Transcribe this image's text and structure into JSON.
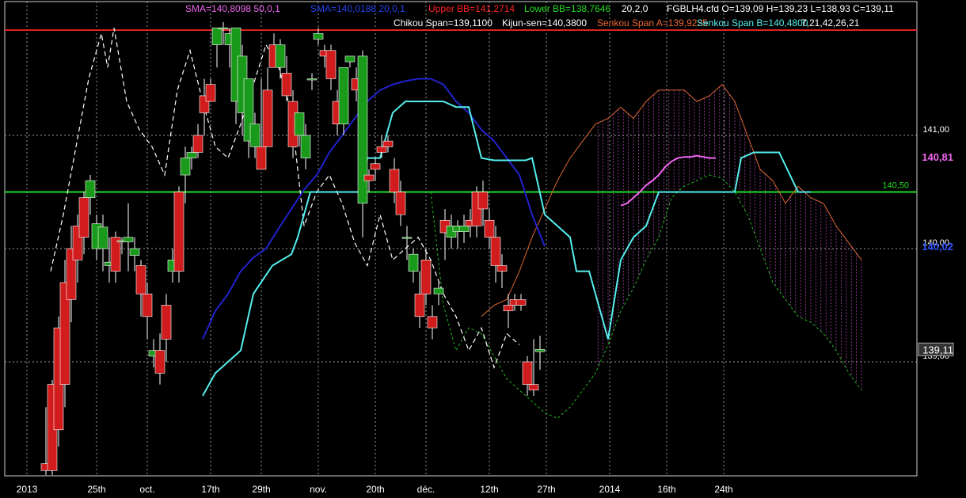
{
  "header": {
    "sma1": "SMA=140,8098  50,0,1",
    "sma2": "SMA=140,0188  20,0,1",
    "upper_bb": "Upper BB=141,2714",
    "lower_bb": "Lower BB=138,7646",
    "bb_params": "20,2,0",
    "ohlc": "FGBLH4.cfd O=139,09 H=139,23 L=138,93 C=139,11",
    "chikou": "Chikou Span=139,1100",
    "kijun": "Kijun-sen=140,3800",
    "senkou_a": "Senkou Span A=139,9225",
    "senkou_b": "Senkou Span B=140,4800",
    "ichimoku_params": "7,21,42,26,21"
  },
  "colors": {
    "background": "#000000",
    "bull": "#1a9a1a",
    "bear": "#d01c1c",
    "upper_bb": "#dd2222",
    "hline": "#22dd22",
    "sma50": "#ee66ee",
    "sma20": "#2222cc",
    "kijun": "#55eeee",
    "chikou": "#ffffff",
    "senkou_a": "#dd6633",
    "senkou_b": "#22bb22",
    "sma1_label": "#ee66ee",
    "sma2_label": "#2244ee",
    "upper_label": "#ff2222",
    "lower_label": "#22dd22",
    "white_label": "#ffffff",
    "senkou_a_label": "#ee6633",
    "senkou_b_label": "#55eeee"
  },
  "chart_data": {
    "type": "candlestick",
    "instrument": "FGBLH4.cfd",
    "ylim": [
      138.0,
      142.0
    ],
    "y_ticks": [
      "141,00",
      "140,00",
      "139,00"
    ],
    "y_tick_values": [
      141.0,
      140.0,
      139.0
    ],
    "x_ticks": [
      "2013",
      "25th",
      "oct.",
      "17th",
      "29th",
      "nov.",
      "20th",
      "déc.",
      "12th",
      "27th",
      "2014",
      "16th",
      "24th"
    ],
    "x_tick_index": [
      0,
      11,
      19,
      29,
      37,
      46,
      55,
      63,
      73,
      82,
      92,
      101,
      110
    ],
    "price_labels": {
      "sma50": "140,81",
      "sma20": "140,02",
      "last": "139,11",
      "hline": "140,50"
    },
    "sma50_value": 140.81,
    "sma20_value": 140.02,
    "last_value": 139.11,
    "hline_value": 140.5,
    "upper_bb_value": 141.93,
    "candles": [
      [
        138.1,
        138.04,
        138.0,
        138.6
      ],
      [
        138.8,
        138.04,
        138.0,
        138.84
      ],
      [
        139.3,
        138.4,
        138.25,
        139.4
      ],
      [
        139.7,
        138.8,
        138.6,
        139.9
      ],
      [
        140.0,
        139.55,
        139.35,
        140.2
      ],
      [
        140.2,
        139.9,
        139.7,
        140.3
      ],
      [
        140.45,
        140.1,
        139.95,
        140.5
      ],
      [
        140.45,
        140.6,
        140.3,
        140.65
      ],
      [
        140.0,
        140.22,
        139.9,
        140.3
      ],
      [
        140.0,
        140.19,
        139.8,
        140.3
      ],
      [
        139.85,
        139.88,
        139.7,
        140.1
      ],
      [
        140.1,
        139.8,
        139.7,
        140.15
      ],
      [
        140.06,
        140.07,
        139.95,
        140.1
      ],
      [
        140.06,
        140.1,
        139.8,
        140.4
      ],
      [
        139.94,
        140.0,
        139.8,
        140.1
      ],
      [
        139.85,
        139.6,
        139.4,
        139.9
      ],
      [
        139.6,
        139.4,
        139.2,
        139.7
      ],
      [
        139.05,
        139.1,
        138.95,
        139.2
      ],
      [
        139.1,
        138.9,
        138.8,
        139.25
      ],
      [
        139.5,
        139.2,
        139.0,
        139.6
      ],
      [
        139.8,
        139.9,
        139.7,
        140.0
      ],
      [
        140.5,
        139.8,
        139.7,
        140.55
      ],
      [
        140.65,
        140.8,
        140.4,
        140.9
      ],
      [
        140.8,
        140.85,
        140.7,
        140.9
      ],
      [
        141.0,
        140.85,
        140.8,
        141.1
      ],
      [
        141.35,
        141.2,
        141.0,
        141.5
      ],
      [
        141.45,
        141.3,
        141.4,
        141.5
      ],
      [
        141.8,
        141.95,
        141.6,
        141.9
      ],
      [
        141.95,
        141.95,
        141.8,
        142.0
      ],
      [
        141.8,
        141.9,
        141.6,
        141.95
      ],
      [
        141.3,
        141.95,
        141.1,
        141.9
      ],
      [
        141.2,
        141.7,
        141.0,
        141.8
      ],
      [
        140.95,
        141.5,
        140.8,
        141.5
      ],
      [
        140.9,
        141.1,
        140.8,
        141.2
      ],
      [
        140.9,
        140.7,
        140.7,
        141.5
      ],
      [
        141.4,
        140.9,
        141.0,
        141.6
      ],
      [
        141.8,
        141.6,
        141.6,
        141.9
      ],
      [
        141.6,
        141.8,
        141.5,
        141.85
      ],
      [
        141.55,
        141.35,
        141.3,
        141.7
      ],
      [
        141.3,
        140.9,
        140.8,
        141.4
      ],
      [
        141.0,
        141.2,
        140.9,
        141.1
      ],
      [
        140.8,
        141.0,
        140.7,
        141.1
      ],
      [
        141.5,
        141.5,
        141.4,
        141.55
      ],
      [
        141.85,
        141.9,
        141.8,
        141.95
      ],
      [
        141.75,
        141.7,
        141.6,
        141.8
      ],
      [
        141.75,
        141.5,
        141.4,
        141.8
      ],
      [
        141.3,
        141.1,
        141.0,
        141.4
      ],
      [
        141.1,
        141.6,
        141.0,
        141.6
      ],
      [
        141.65,
        141.7,
        141.6,
        141.7
      ],
      [
        141.5,
        141.4,
        141.3,
        141.6
      ],
      [
        140.4,
        141.7,
        140.1,
        141.75
      ],
      [
        140.65,
        140.6,
        140.5,
        140.7
      ],
      [
        140.75,
        140.7,
        140.6,
        140.8
      ],
      [
        140.9,
        140.85,
        140.8,
        141.0
      ],
      [
        140.95,
        140.9,
        140.85,
        141.0
      ],
      [
        140.7,
        140.5,
        140.4,
        140.8
      ],
      [
        140.5,
        140.3,
        140.2,
        140.6
      ],
      [
        140.1,
        140.1,
        139.9,
        140.2
      ],
      [
        139.8,
        139.95,
        139.7,
        140.0
      ],
      [
        139.6,
        139.4,
        139.3,
        139.8
      ],
      [
        139.9,
        139.6,
        139.5,
        140.0
      ],
      [
        139.4,
        139.3,
        139.2,
        139.5
      ],
      [
        139.6,
        139.65,
        139.5,
        139.7
      ],
      [
        140.25,
        140.14,
        139.9,
        140.35
      ],
      [
        140.1,
        140.2,
        140.0,
        140.3
      ],
      [
        140.15,
        140.2,
        140.0,
        140.25
      ],
      [
        140.15,
        140.2,
        140.05,
        140.3
      ],
      [
        140.25,
        140.2,
        140.1,
        140.35
      ],
      [
        140.5,
        140.2,
        140.1,
        140.55
      ],
      [
        140.5,
        140.35,
        140.2,
        140.6
      ],
      [
        140.25,
        140.1,
        140.0,
        140.35
      ],
      [
        140.1,
        139.85,
        139.7,
        140.2
      ],
      [
        139.85,
        139.8,
        139.65,
        139.95
      ],
      [
        139.5,
        139.45,
        139.3,
        139.6
      ],
      [
        139.55,
        139.5,
        139.45,
        139.6
      ],
      [
        139.55,
        139.5,
        139.45,
        139.6
      ],
      [
        139.0,
        138.8,
        138.7,
        139.05
      ],
      [
        138.8,
        138.75,
        138.7,
        139.2
      ],
      [
        139.09,
        139.11,
        138.93,
        139.23
      ]
    ],
    "series": [
      {
        "name": "Upper BB",
        "type": "hline"
      },
      {
        "name": "SMA",
        "params": "50,0,1"
      },
      {
        "name": "SMA",
        "params": "20,0,1"
      },
      {
        "name": "Kijun-sen"
      },
      {
        "name": "Chikou Span"
      },
      {
        "name": "Senkou Span A"
      },
      {
        "name": "Senkou Span B"
      }
    ],
    "sma50": [
      [
        90,
        140.38
      ],
      [
        91,
        140.4
      ],
      [
        92,
        140.45
      ],
      [
        93,
        140.5
      ],
      [
        94,
        140.56
      ],
      [
        95,
        140.6
      ],
      [
        96,
        140.65
      ],
      [
        97,
        140.72
      ],
      [
        98,
        140.77
      ],
      [
        99,
        140.8
      ],
      [
        100,
        140.81
      ],
      [
        101,
        140.81
      ],
      [
        102,
        140.82
      ],
      [
        103,
        140.81
      ],
      [
        104,
        140.8
      ],
      [
        105,
        140.8
      ]
    ],
    "sma20": [
      [
        24,
        139.2
      ],
      [
        26,
        139.45
      ],
      [
        28,
        139.6
      ],
      [
        30,
        139.8
      ],
      [
        32,
        139.92
      ],
      [
        34,
        140.0
      ],
      [
        36,
        140.18
      ],
      [
        38,
        140.35
      ],
      [
        40,
        140.52
      ],
      [
        42,
        140.65
      ],
      [
        44,
        140.85
      ],
      [
        46,
        141.0
      ],
      [
        48,
        141.15
      ],
      [
        50,
        141.3
      ],
      [
        52,
        141.4
      ],
      [
        54,
        141.45
      ],
      [
        56,
        141.48
      ],
      [
        58,
        141.5
      ],
      [
        60,
        141.5
      ],
      [
        62,
        141.45
      ],
      [
        64,
        141.3
      ],
      [
        66,
        141.2
      ],
      [
        68,
        141.05
      ],
      [
        70,
        140.95
      ],
      [
        72,
        140.8
      ],
      [
        74,
        140.65
      ],
      [
        76,
        140.3
      ],
      [
        78,
        140.02
      ]
    ],
    "kijun": [
      [
        24,
        138.7
      ],
      [
        26,
        138.9
      ],
      [
        30,
        139.1
      ],
      [
        32,
        139.6
      ],
      [
        35,
        139.85
      ],
      [
        38,
        139.95
      ],
      [
        39,
        140.1
      ],
      [
        40,
        140.3
      ],
      [
        41,
        140.5
      ],
      [
        43,
        140.5
      ],
      [
        47,
        140.5
      ],
      [
        49,
        140.5
      ],
      [
        50,
        140.8
      ],
      [
        52,
        140.8
      ],
      [
        54,
        141.2
      ],
      [
        56,
        141.3
      ],
      [
        58,
        141.3
      ],
      [
        60,
        141.3
      ],
      [
        62,
        141.3
      ],
      [
        64,
        141.25
      ],
      [
        66,
        141.25
      ],
      [
        68,
        140.8
      ],
      [
        70,
        140.78
      ],
      [
        72,
        140.78
      ],
      [
        74,
        140.78
      ],
      [
        75,
        140.78
      ],
      [
        76,
        140.8
      ],
      [
        78,
        140.3
      ],
      [
        80,
        140.2
      ],
      [
        82,
        140.1
      ],
      [
        83,
        139.8
      ],
      [
        85,
        139.8
      ],
      [
        87,
        139.4
      ],
      [
        88,
        139.2
      ],
      [
        90,
        139.9
      ],
      [
        92,
        140.1
      ],
      [
        94,
        140.2
      ],
      [
        96,
        140.5
      ],
      [
        100,
        140.5
      ],
      [
        104,
        140.5
      ],
      [
        108,
        140.5
      ],
      [
        109,
        140.8
      ],
      [
        111,
        140.85
      ],
      [
        113,
        140.85
      ],
      [
        115,
        140.85
      ],
      [
        118,
        140.5
      ],
      [
        120,
        140.5
      ]
    ],
    "chikou": [
      [
        0,
        139.8
      ],
      [
        2,
        140.3
      ],
      [
        4,
        140.9
      ],
      [
        6,
        141.5
      ],
      [
        8,
        141.9
      ],
      [
        9,
        141.6
      ],
      [
        10,
        141.95
      ],
      [
        12,
        141.3
      ],
      [
        14,
        141.05
      ],
      [
        16,
        140.9
      ],
      [
        18,
        140.65
      ],
      [
        20,
        141.4
      ],
      [
        22,
        141.75
      ],
      [
        24,
        141.3
      ],
      [
        26,
        140.9
      ],
      [
        28,
        140.8
      ],
      [
        30,
        141.1
      ],
      [
        32,
        141.45
      ],
      [
        34,
        141.8
      ],
      [
        36,
        141.6
      ],
      [
        38,
        141.2
      ],
      [
        40,
        140.2
      ],
      [
        42,
        140.5
      ],
      [
        44,
        140.65
      ],
      [
        46,
        140.4
      ],
      [
        48,
        140.05
      ],
      [
        50,
        139.85
      ],
      [
        52,
        140.3
      ],
      [
        54,
        139.9
      ],
      [
        56,
        140.0
      ],
      [
        58,
        140.1
      ],
      [
        60,
        139.9
      ],
      [
        62,
        139.6
      ],
      [
        64,
        139.4
      ],
      [
        66,
        139.1
      ],
      [
        68,
        139.3
      ],
      [
        70,
        138.95
      ],
      [
        72,
        139.25
      ],
      [
        74,
        139.15
      ]
    ],
    "senkou_a": [
      [
        68,
        139.4
      ],
      [
        70,
        139.5
      ],
      [
        72,
        139.55
      ],
      [
        74,
        139.8
      ],
      [
        76,
        140.1
      ],
      [
        78,
        140.35
      ],
      [
        80,
        140.6
      ],
      [
        82,
        140.8
      ],
      [
        84,
        140.95
      ],
      [
        86,
        141.1
      ],
      [
        88,
        141.15
      ],
      [
        90,
        141.25
      ],
      [
        92,
        141.15
      ],
      [
        94,
        141.3
      ],
      [
        96,
        141.4
      ],
      [
        98,
        141.4
      ],
      [
        100,
        141.4
      ],
      [
        102,
        141.3
      ],
      [
        104,
        141.35
      ],
      [
        106,
        141.45
      ],
      [
        108,
        141.3
      ],
      [
        110,
        141.0
      ],
      [
        112,
        140.7
      ],
      [
        114,
        140.6
      ],
      [
        116,
        140.4
      ],
      [
        118,
        140.55
      ],
      [
        120,
        140.45
      ],
      [
        122,
        140.4
      ],
      [
        124,
        140.2
      ],
      [
        126,
        140.05
      ],
      [
        128,
        139.9
      ]
    ],
    "senkou_b": [
      [
        60,
        140.5
      ],
      [
        62,
        139.5
      ],
      [
        64,
        139.1
      ],
      [
        66,
        139.3
      ],
      [
        68,
        139.25
      ],
      [
        70,
        139.05
      ],
      [
        72,
        138.85
      ],
      [
        74,
        138.75
      ],
      [
        76,
        138.65
      ],
      [
        78,
        138.55
      ],
      [
        80,
        138.5
      ],
      [
        82,
        138.6
      ],
      [
        84,
        138.75
      ],
      [
        86,
        138.9
      ],
      [
        88,
        139.15
      ],
      [
        90,
        139.45
      ],
      [
        92,
        139.65
      ],
      [
        94,
        139.9
      ],
      [
        96,
        140.1
      ],
      [
        98,
        140.45
      ],
      [
        100,
        140.55
      ],
      [
        102,
        140.6
      ],
      [
        104,
        140.65
      ],
      [
        106,
        140.62
      ],
      [
        108,
        140.5
      ],
      [
        110,
        140.3
      ],
      [
        112,
        140.0
      ],
      [
        114,
        139.7
      ],
      [
        116,
        139.55
      ],
      [
        118,
        139.4
      ],
      [
        120,
        139.35
      ],
      [
        122,
        139.25
      ],
      [
        124,
        139.1
      ],
      [
        126,
        138.9
      ],
      [
        128,
        138.75
      ]
    ]
  }
}
